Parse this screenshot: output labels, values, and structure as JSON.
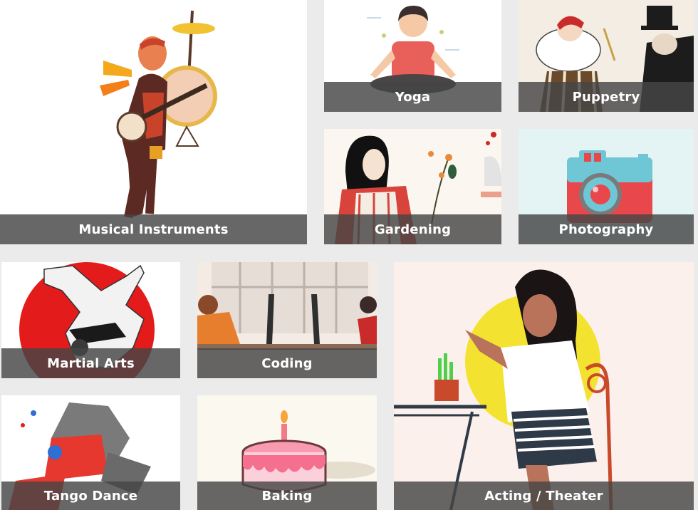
{
  "categories": {
    "musical_instruments": {
      "label": "Musical Instruments",
      "bg": "#ffffff"
    },
    "yoga": {
      "label": "Yoga",
      "bg": "#ffffff"
    },
    "puppetry": {
      "label": "Puppetry",
      "bg": "#f3ede4"
    },
    "gardening": {
      "label": "Gardening",
      "bg": "#fbf6ef"
    },
    "photography": {
      "label": "Photography",
      "bg": "#e4f3f4"
    },
    "martial_arts": {
      "label": "Martial Arts",
      "bg": "#ffffff"
    },
    "coding": {
      "label": "Coding",
      "bg": "#f4ece4"
    },
    "acting_theater": {
      "label": "Acting / Theater",
      "bg": "#fcf0ec"
    },
    "tango_dance": {
      "label": "Tango Dance",
      "bg": "#ffffff"
    },
    "baking": {
      "label": "Baking",
      "bg": "#fbf8f0"
    }
  }
}
